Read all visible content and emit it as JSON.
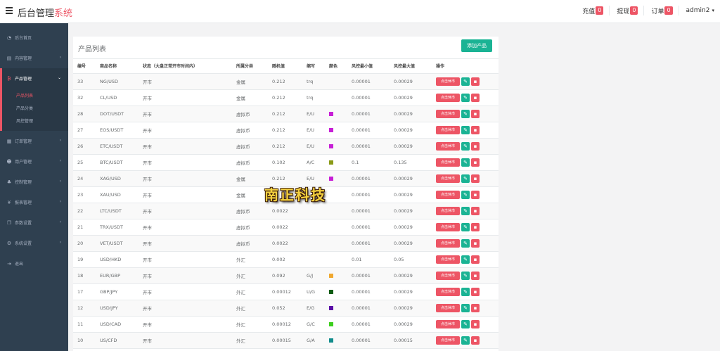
{
  "header": {
    "brand_main": "后台管理",
    "brand_accent": "系统",
    "recharge_label": "充值",
    "recharge_count": "0",
    "withdraw_label": "提现",
    "withdraw_count": "0",
    "orders_label": "订单",
    "orders_count": "0",
    "user": "admin2"
  },
  "sidebar": {
    "items": [
      {
        "label": "后台首页",
        "icon": "dashboard-icon"
      },
      {
        "label": "内容管理",
        "icon": "content-icon"
      },
      {
        "label": "产品管理",
        "icon": "bitcoin-icon"
      },
      {
        "label": "订单管理",
        "icon": "order-icon"
      },
      {
        "label": "用户管理",
        "icon": "user-icon"
      },
      {
        "label": "控制管理",
        "icon": "control-icon"
      },
      {
        "label": "报表管理",
        "icon": "yen-icon"
      },
      {
        "label": "参数设置",
        "icon": "params-icon"
      },
      {
        "label": "系统设置",
        "icon": "gears-icon"
      },
      {
        "label": "退出",
        "icon": "logout-icon"
      }
    ],
    "sub_items": [
      "产品列表",
      "产品分类",
      "风控管理"
    ]
  },
  "panel": {
    "title": "产品列表",
    "add_label": "添加产品",
    "columns": [
      "编号",
      "商品名称",
      "状态（大盘正常开市时间内）",
      "所属分类",
      "随机值",
      "缩写",
      "颜色",
      "风控最小值",
      "风控最大值",
      "操作"
    ],
    "op_close_label": "点击休市",
    "rows": [
      {
        "id": "33",
        "name": "NG/USD",
        "status": "开市",
        "category": "金属",
        "random": "0.212",
        "abbr": "trq",
        "color": "",
        "min": "0.00001",
        "max": "0.00029"
      },
      {
        "id": "32",
        "name": "CL/USD",
        "status": "开市",
        "category": "金属",
        "random": "0.212",
        "abbr": "trq",
        "color": "",
        "min": "0.00001",
        "max": "0.00029"
      },
      {
        "id": "28",
        "name": "DOT/USDT",
        "status": "开市",
        "category": "虚拟币",
        "random": "0.212",
        "abbr": "E/U",
        "color": "#c71fd6",
        "min": "0.00001",
        "max": "0.00029"
      },
      {
        "id": "27",
        "name": "EOS/USDT",
        "status": "开市",
        "category": "虚拟币",
        "random": "0.212",
        "abbr": "E/U",
        "color": "#c71fd6",
        "min": "0.00001",
        "max": "0.00029"
      },
      {
        "id": "26",
        "name": "ETC/USDT",
        "status": "开市",
        "category": "虚拟币",
        "random": "0.212",
        "abbr": "E/U",
        "color": "#c71fd6",
        "min": "0.00001",
        "max": "0.00029"
      },
      {
        "id": "25",
        "name": "BTC/USDT",
        "status": "开市",
        "category": "虚拟币",
        "random": "0.102",
        "abbr": "A/C",
        "color": "#8a9a17",
        "min": "0.1",
        "max": "0.135"
      },
      {
        "id": "24",
        "name": "XAG/USD",
        "status": "开市",
        "category": "金属",
        "random": "0.212",
        "abbr": "E/U",
        "color": "#c71fd6",
        "min": "0.00001",
        "max": "0.00029"
      },
      {
        "id": "23",
        "name": "XAU/USD",
        "status": "开市",
        "category": "金属",
        "random": "",
        "abbr": "",
        "color": "",
        "min": "0.00001",
        "max": "0.00029"
      },
      {
        "id": "22",
        "name": "LTC/USDT",
        "status": "开市",
        "category": "虚拟币",
        "random": "0.0022",
        "abbr": "",
        "color": "",
        "min": "0.00001",
        "max": "0.00029"
      },
      {
        "id": "21",
        "name": "TRX/USDT",
        "status": "开市",
        "category": "虚拟币",
        "random": "0.0022",
        "abbr": "",
        "color": "",
        "min": "0.00001",
        "max": "0.00029"
      },
      {
        "id": "20",
        "name": "VET/USDT",
        "status": "开市",
        "category": "虚拟币",
        "random": "0.0022",
        "abbr": "",
        "color": "",
        "min": "0.00001",
        "max": "0.00029"
      },
      {
        "id": "19",
        "name": "USD/HKD",
        "status": "开市",
        "category": "外汇",
        "random": "0.002",
        "abbr": "",
        "color": "",
        "min": "0.01",
        "max": "0.05"
      },
      {
        "id": "18",
        "name": "EUR/GBP",
        "status": "开市",
        "category": "外汇",
        "random": "0.092",
        "abbr": "G/J",
        "color": "#f0a830",
        "min": "0.00001",
        "max": "0.00029"
      },
      {
        "id": "17",
        "name": "GBP/JPY",
        "status": "开市",
        "category": "外汇",
        "random": "0.00012",
        "abbr": "U/G",
        "color": "#0d5c12",
        "min": "0.00001",
        "max": "0.00029"
      },
      {
        "id": "12",
        "name": "USD/JPY",
        "status": "开市",
        "category": "外汇",
        "random": "0.052",
        "abbr": "E/G",
        "color": "#5a0ea6",
        "min": "0.00001",
        "max": "0.00029"
      },
      {
        "id": "11",
        "name": "USD/CAD",
        "status": "开市",
        "category": "外汇",
        "random": "0.00012",
        "abbr": "G/C",
        "color": "#3ccf1d",
        "min": "0.00001",
        "max": "0.00029"
      },
      {
        "id": "10",
        "name": "US/CFD",
        "status": "开市",
        "category": "外汇",
        "random": "0.00015",
        "abbr": "G/A",
        "color": "#128c8c",
        "min": "0.00001",
        "max": "0.00015"
      }
    ]
  },
  "watermark": "南正科技"
}
